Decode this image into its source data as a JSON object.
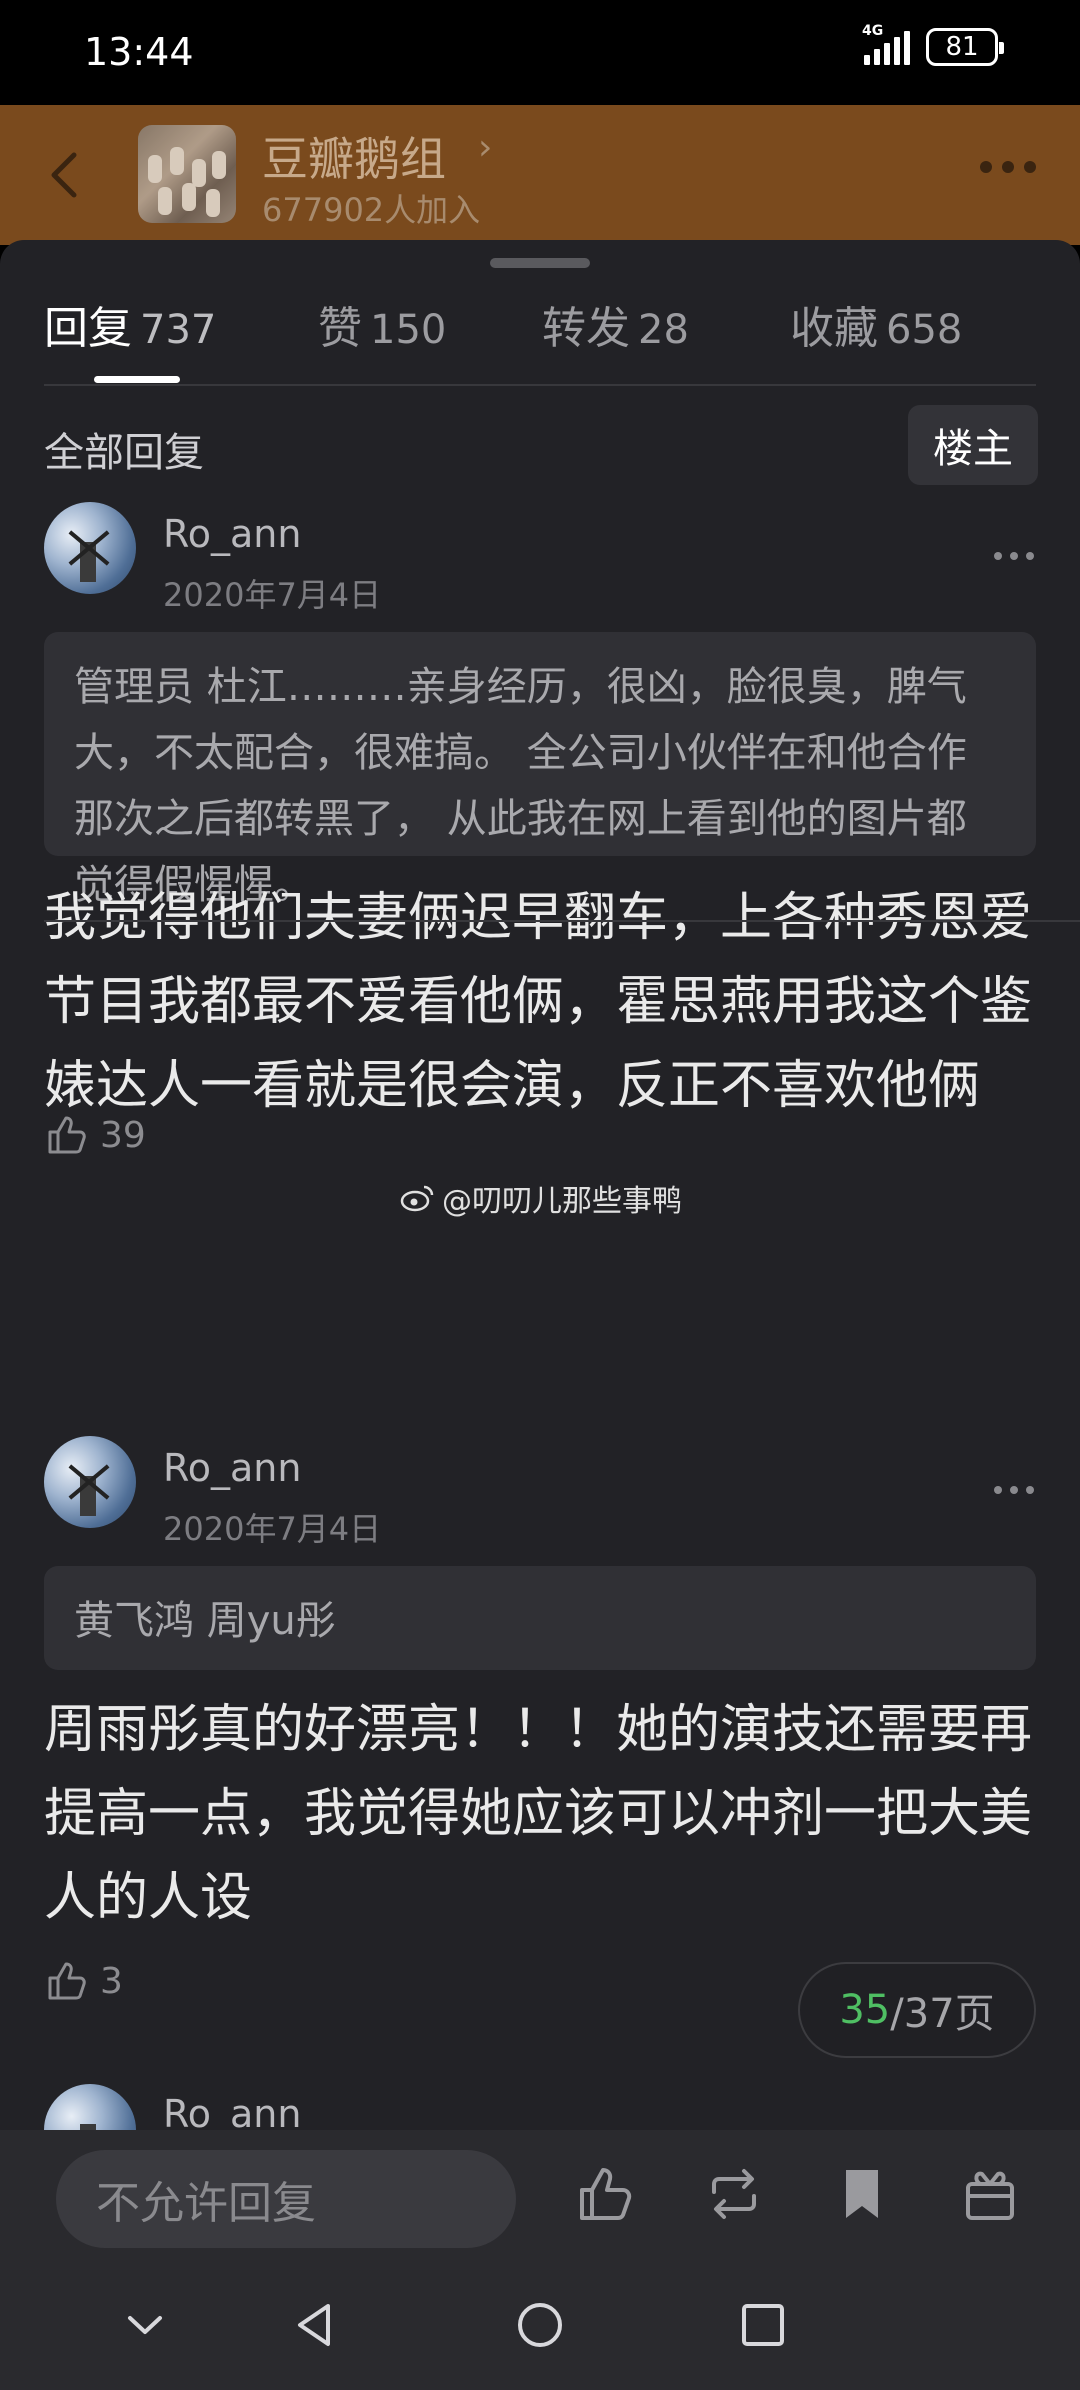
{
  "status": {
    "time": "13:44",
    "network": "4G",
    "battery": "81"
  },
  "group": {
    "name": "豆瓣鹅组",
    "members": "677902人加入"
  },
  "tabs": [
    {
      "label": "回复",
      "count": "737"
    },
    {
      "label": "赞",
      "count": "150"
    },
    {
      "label": "转发",
      "count": "28"
    },
    {
      "label": "收藏",
      "count": "658"
    }
  ],
  "filter": {
    "all_replies": "全部回复",
    "op_button": "楼主"
  },
  "replies": [
    {
      "user": "Ro_ann",
      "date": "2020年7月4日",
      "quote_author": "管理员",
      "quote_text": "杜江………亲身经历，很凶，脸很臭，脾气大，不太配合，很难搞。 全公司小伙伴在和他合作那次之后都转黑了， 从此我在网上看到他的图片都觉得假惺惺。",
      "text": "我觉得他们夫妻俩迟早翻车，上各种秀恩爱节目我都最不爱看他俩，霍思燕用我这个鉴婊达人一看就是很会演，反正不喜欢他俩",
      "likes": "39"
    },
    {
      "user": "Ro_ann",
      "date": "2020年7月4日",
      "quote_author": "黄飞鸿",
      "quote_text": "周yu彤",
      "text": "周雨彤真的好漂亮！！！她的演技还需要再提高一点，我觉得她应该可以冲剂一把大美人的人设",
      "likes": "3"
    },
    {
      "user": "Ro_ann"
    }
  ],
  "watermark": "@叨叨儿那些事鸭",
  "pagination": {
    "current": "35",
    "total": "/37页"
  },
  "bottom": {
    "reply_placeholder": "不允许回复"
  },
  "colors": {
    "header": "#7a4a1d",
    "sheet": "#222226",
    "page_current": "#4fbf63"
  }
}
